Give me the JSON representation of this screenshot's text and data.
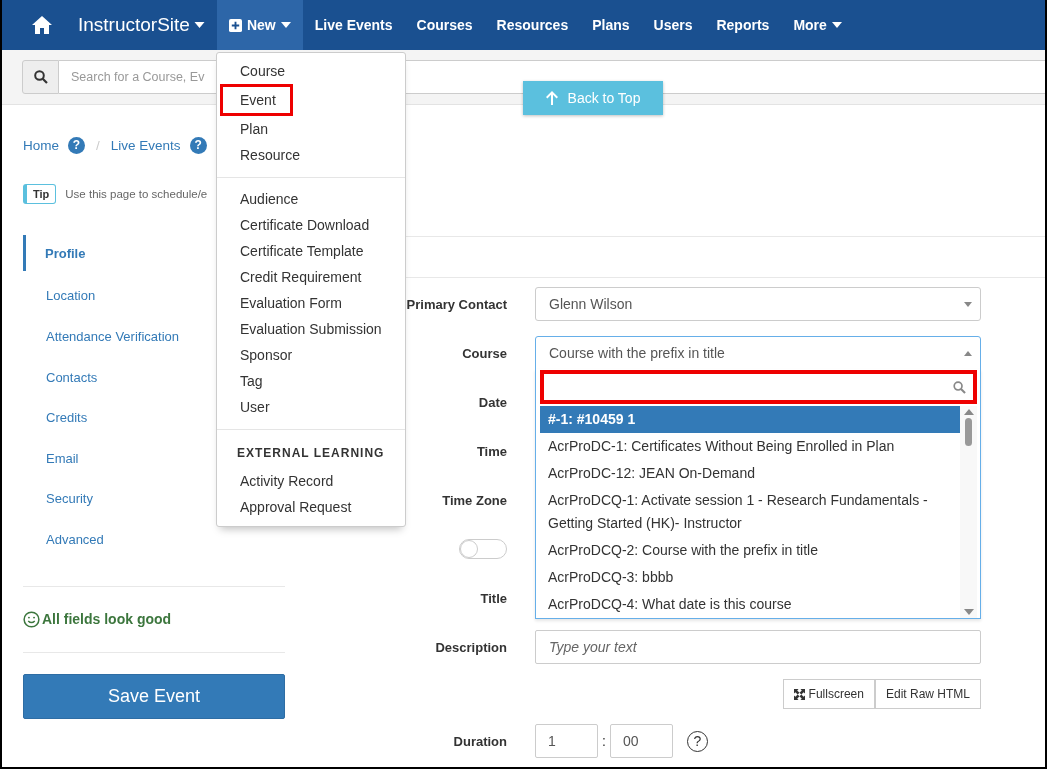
{
  "nav": {
    "brand": "InstructorSite",
    "items": [
      {
        "label": "New",
        "kind": "new",
        "selected": true
      },
      {
        "label": "Live Events",
        "kind": "link",
        "selected": false
      },
      {
        "label": "Courses",
        "kind": "link",
        "selected": false
      },
      {
        "label": "Resources",
        "kind": "link",
        "selected": false
      },
      {
        "label": "Plans",
        "kind": "link",
        "selected": false
      },
      {
        "label": "Users",
        "kind": "link",
        "selected": false
      },
      {
        "label": "Reports",
        "kind": "link",
        "selected": false
      },
      {
        "label": "More",
        "kind": "dropdown",
        "selected": false
      }
    ]
  },
  "search": {
    "placeholder": "Search for a Course, Ev"
  },
  "new_menu": {
    "groups": [
      {
        "items": [
          {
            "label": "Course",
            "highlighted": false
          },
          {
            "label": "Event",
            "highlighted": true
          },
          {
            "label": "Plan",
            "highlighted": false
          },
          {
            "label": "Resource",
            "highlighted": false
          }
        ]
      },
      {
        "items": [
          {
            "label": "Audience",
            "highlighted": false
          },
          {
            "label": "Certificate Download",
            "highlighted": false
          },
          {
            "label": "Certificate Template",
            "highlighted": false
          },
          {
            "label": "Credit Requirement",
            "highlighted": false
          },
          {
            "label": "Evaluation Form",
            "highlighted": false
          },
          {
            "label": "Evaluation Submission",
            "highlighted": false
          },
          {
            "label": "Sponsor",
            "highlighted": false
          },
          {
            "label": "Tag",
            "highlighted": false
          },
          {
            "label": "User",
            "highlighted": false
          }
        ]
      },
      {
        "header": "EXTERNAL LEARNING",
        "items": [
          {
            "label": "Activity Record",
            "highlighted": false
          },
          {
            "label": "Approval Request",
            "highlighted": false
          }
        ]
      }
    ]
  },
  "back_to_top": {
    "label": "Back to Top"
  },
  "breadcrumb": [
    {
      "label": "Home",
      "help": "?"
    },
    {
      "label": "Live Events",
      "help": "?"
    }
  ],
  "breadcrumb_separator": "/",
  "tip": {
    "badge": "Tip",
    "text": "Use this page to schedule/e"
  },
  "sidebar": {
    "items": [
      {
        "label": "Profile",
        "selected": true
      },
      {
        "label": "Location",
        "selected": false
      },
      {
        "label": "Attendance Verification",
        "selected": false
      },
      {
        "label": "Contacts",
        "selected": false
      },
      {
        "label": "Credits",
        "selected": false
      },
      {
        "label": "Email",
        "selected": false
      },
      {
        "label": "Security",
        "selected": false
      },
      {
        "label": "Advanced",
        "selected": false
      }
    ]
  },
  "validation": {
    "message": "All fields look good"
  },
  "save_button": "Save Event",
  "form": {
    "rows": [
      {
        "kind": "select",
        "label": "Primary Contact",
        "value": "Glenn Wilson",
        "expanded": false
      },
      {
        "kind": "select",
        "label": "Course",
        "value": "Course with the prefix in title",
        "expanded": true,
        "search_highlighted": true,
        "options": [
          {
            "label": "#-1: #10459 1",
            "selected": true
          },
          {
            "label": "AcrProDC-1: Certificates Without Being Enrolled in Plan",
            "selected": false
          },
          {
            "label": "AcrProDC-12: JEAN On-Demand",
            "selected": false
          },
          {
            "label": "AcrProDCQ-1: Activate session 1 - Research Fundamentals - Getting Started (HK)- Instructor",
            "selected": false
          },
          {
            "label": "AcrProDCQ-2: Course with the prefix in title",
            "selected": false
          },
          {
            "label": "AcrProDCQ-3: bbbb",
            "selected": false
          },
          {
            "label": "AcrProDCQ-4: What date is this course",
            "selected": false
          }
        ]
      },
      {
        "kind": "covered",
        "label": "Date"
      },
      {
        "kind": "covered",
        "label": "Time"
      },
      {
        "kind": "covered",
        "label": "Time Zone"
      },
      {
        "kind": "toggle",
        "on": false
      },
      {
        "kind": "covered",
        "label": "Title"
      },
      {
        "kind": "text",
        "label": "Description",
        "placeholder": "Type your text"
      },
      {
        "kind": "buttons",
        "buttons": [
          {
            "label": "Fullscreen",
            "kind": "fullscreen"
          },
          {
            "label": "Edit Raw HTML",
            "kind": "plain"
          }
        ]
      },
      {
        "kind": "duration",
        "label": "Duration",
        "hours": "1",
        "separator": ":",
        "minutes": "00",
        "help": "?"
      }
    ]
  }
}
